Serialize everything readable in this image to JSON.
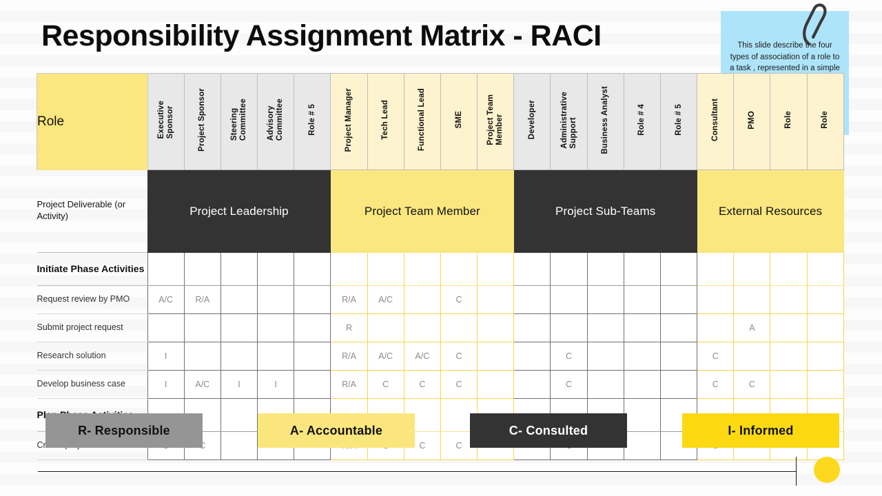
{
  "slide": {
    "title": "Responsibility Assignment Matrix - RACI"
  },
  "sticky_note": {
    "text": "This slide describe the four types of association of a role to a task , represented in a simple task vs. role diagram or matrix.",
    "color": "#aee4f9",
    "icon": "paperclip-icon"
  },
  "matrix": {
    "role_header": "Role",
    "deliverable_header": "Project Deliverable (or Activity)",
    "groups": [
      {
        "label": "Project Leadership",
        "style": "dark",
        "span": 5
      },
      {
        "label": "Project Team Member",
        "style": "light",
        "span": 5
      },
      {
        "label": "Project Sub-Teams",
        "style": "dark",
        "span": 5
      },
      {
        "label": "External Resources",
        "style": "light",
        "span": 4
      }
    ],
    "columns": [
      {
        "label": "Executive\nSponsor",
        "group": 0,
        "style": "grey"
      },
      {
        "label": "Project Sponsor",
        "group": 0,
        "style": "grey"
      },
      {
        "label": "Steering\nCommittee",
        "group": 0,
        "style": "grey"
      },
      {
        "label": "Advisory\nCommittee",
        "group": 0,
        "style": "grey"
      },
      {
        "label": "Role # 5",
        "group": 0,
        "style": "grey"
      },
      {
        "label": "Project Manager",
        "group": 1,
        "style": "cream"
      },
      {
        "label": "Tech Lead",
        "group": 1,
        "style": "cream"
      },
      {
        "label": "Functional Lead",
        "group": 1,
        "style": "cream"
      },
      {
        "label": "SME",
        "group": 1,
        "style": "cream"
      },
      {
        "label": "Project Team\nMember",
        "group": 1,
        "style": "cream"
      },
      {
        "label": "Developer",
        "group": 2,
        "style": "grey"
      },
      {
        "label": "Administrative\nSupport",
        "group": 2,
        "style": "grey"
      },
      {
        "label": "Business Analyst",
        "group": 2,
        "style": "grey"
      },
      {
        "label": "Role # 4",
        "group": 2,
        "style": "grey"
      },
      {
        "label": "Role # 5",
        "group": 2,
        "style": "grey"
      },
      {
        "label": "Consultant",
        "group": 3,
        "style": "cream"
      },
      {
        "label": "PMO",
        "group": 3,
        "style": "cream"
      },
      {
        "label": "Role",
        "group": 3,
        "style": "cream"
      },
      {
        "label": "Role",
        "group": 3,
        "style": "cream"
      }
    ],
    "rows": [
      {
        "label": "Initiate Phase Activities",
        "type": "phase",
        "cells": [
          "",
          "",
          "",
          "",
          "",
          "",
          "",
          "",
          "",
          "",
          "",
          "",
          "",
          "",
          "",
          "",
          "",
          "",
          ""
        ]
      },
      {
        "label": "Request review by PMO",
        "type": "task",
        "cells": [
          "A/C",
          "R/A",
          "",
          "",
          "",
          "R/A",
          "A/C",
          "",
          "C",
          "",
          "",
          "",
          "",
          "",
          "",
          "",
          "",
          "",
          ""
        ]
      },
      {
        "label": "Submit project request",
        "type": "task",
        "cells": [
          "",
          "",
          "",
          "",
          "",
          "R",
          "",
          "",
          "",
          "",
          "",
          "",
          "",
          "",
          "",
          "",
          "A",
          "",
          ""
        ]
      },
      {
        "label": "Research solution",
        "type": "task",
        "cells": [
          "I",
          "",
          "",
          "",
          "",
          "R/A",
          "A/C",
          "A/C",
          "C",
          "",
          "",
          "C",
          "",
          "",
          "",
          "C",
          "",
          "",
          ""
        ]
      },
      {
        "label": "Develop business case",
        "type": "task",
        "cells": [
          "I",
          "A/C",
          "I",
          "I",
          "",
          "R/A",
          "C",
          "C",
          "C",
          "",
          "",
          "C",
          "",
          "",
          "",
          "C",
          "C",
          "",
          ""
        ]
      },
      {
        "label": "Plan Phase Activities",
        "type": "phase",
        "cells": [
          "",
          "",
          "",
          "",
          "",
          "",
          "",
          "",
          "",
          "",
          "",
          "",
          "",
          "",
          "",
          "",
          "",
          "",
          ""
        ]
      },
      {
        "label": "Create project charter",
        "type": "task",
        "cells": [
          "C",
          "C",
          "",
          "",
          "",
          "R/A",
          "C",
          "C",
          "C",
          "",
          "",
          "C",
          "",
          "",
          "",
          "C",
          "",
          "",
          ""
        ]
      }
    ]
  },
  "legend": [
    {
      "label": "R- Responsible",
      "color": "#959595"
    },
    {
      "label": "A- Accountable",
      "color": "#fbe67d"
    },
    {
      "label": "C- Consulted",
      "color": "#333333"
    },
    {
      "label": "I- Informed",
      "color": "#fcd912"
    }
  ]
}
